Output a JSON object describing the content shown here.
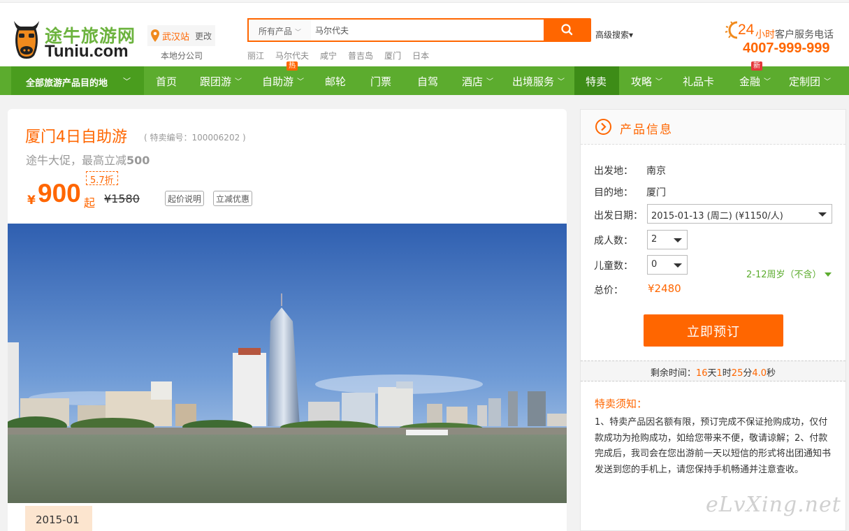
{
  "header": {
    "logo_cn": "途牛旅游网",
    "logo_en": "Tuniu.com",
    "city": "武汉站",
    "city_change": "更改",
    "branch": "本地分公司",
    "search_scope": "所有产品",
    "search_value": "马尔代夫",
    "advanced_search": "高级搜索▾",
    "hot_words": [
      "丽江",
      "马尔代夫",
      "咸宁",
      "普吉岛",
      "厦门",
      "日本"
    ],
    "service_24": "24",
    "service_hours": "小时",
    "service_text": "客户服务电话",
    "service_phone": "4007-999-999"
  },
  "nav": {
    "all_destinations": "全部旅游产品目的地",
    "items": [
      "首页",
      "跟团游",
      "自助游",
      "邮轮",
      "门票",
      "自驾",
      "酒店",
      "出境服务",
      "特卖",
      "攻略",
      "礼品卡",
      "金融",
      "定制团"
    ],
    "badge_hot": "热",
    "badge_new": "新"
  },
  "product": {
    "title": "厦门4日自助游",
    "code": "( 特卖编号：100006202 )",
    "promo_prefix": "途牛大促，最高立减",
    "promo_amount": "500",
    "yen": "¥",
    "price": "900",
    "price_suffix": "起",
    "discount": "5.7折",
    "original_price": "¥1580",
    "btn_price_note": "起价说明",
    "btn_instant_discount": "立减优惠",
    "date_tab": "2015-01"
  },
  "info": {
    "title": "产品信息",
    "depart_label": "出发地：",
    "depart_value": "南京",
    "dest_label": "目的地：",
    "dest_value": "厦门",
    "date_label": "出发日期：",
    "date_value": "2015-01-13 (周二) (¥1150/人)",
    "adults_label": "成人数：",
    "adults_value": "2",
    "children_label": "儿童数：",
    "children_value": "0",
    "child_age_note": "2-12周岁（不含）",
    "total_label": "总价：",
    "total_value": "¥2480",
    "book_button": "立即预订",
    "countdown_label": "剩余时间：",
    "cd_days": "16",
    "cd_days_unit": "天",
    "cd_hours": "1",
    "cd_hours_unit": "时",
    "cd_minutes": "25",
    "cd_minutes_unit": "分",
    "cd_seconds": "4.0",
    "cd_seconds_unit": "秒"
  },
  "notice": {
    "title": "特卖须知：",
    "body": "1、特卖产品因名额有限，预订完成不保证抢购成功，仅付款成功为抢购成功，如给您带来不便，敬请谅解；2、付款完成后，我司会在您出游前一天以短信的形式将出团通知书发送到您的手机上，请您保持手机畅通并注意查收。"
  },
  "watermark": "eLvXing.net",
  "colors": {
    "accent_orange": "#ff6600",
    "nav_green": "#5cac2e",
    "nav_dark_green": "#4a9d1e"
  },
  "icons": [
    "cow-logo-icon",
    "location-pin-icon",
    "search-icon",
    "sun-icon",
    "chevron-down-icon",
    "circle-arrow-right-icon"
  ]
}
